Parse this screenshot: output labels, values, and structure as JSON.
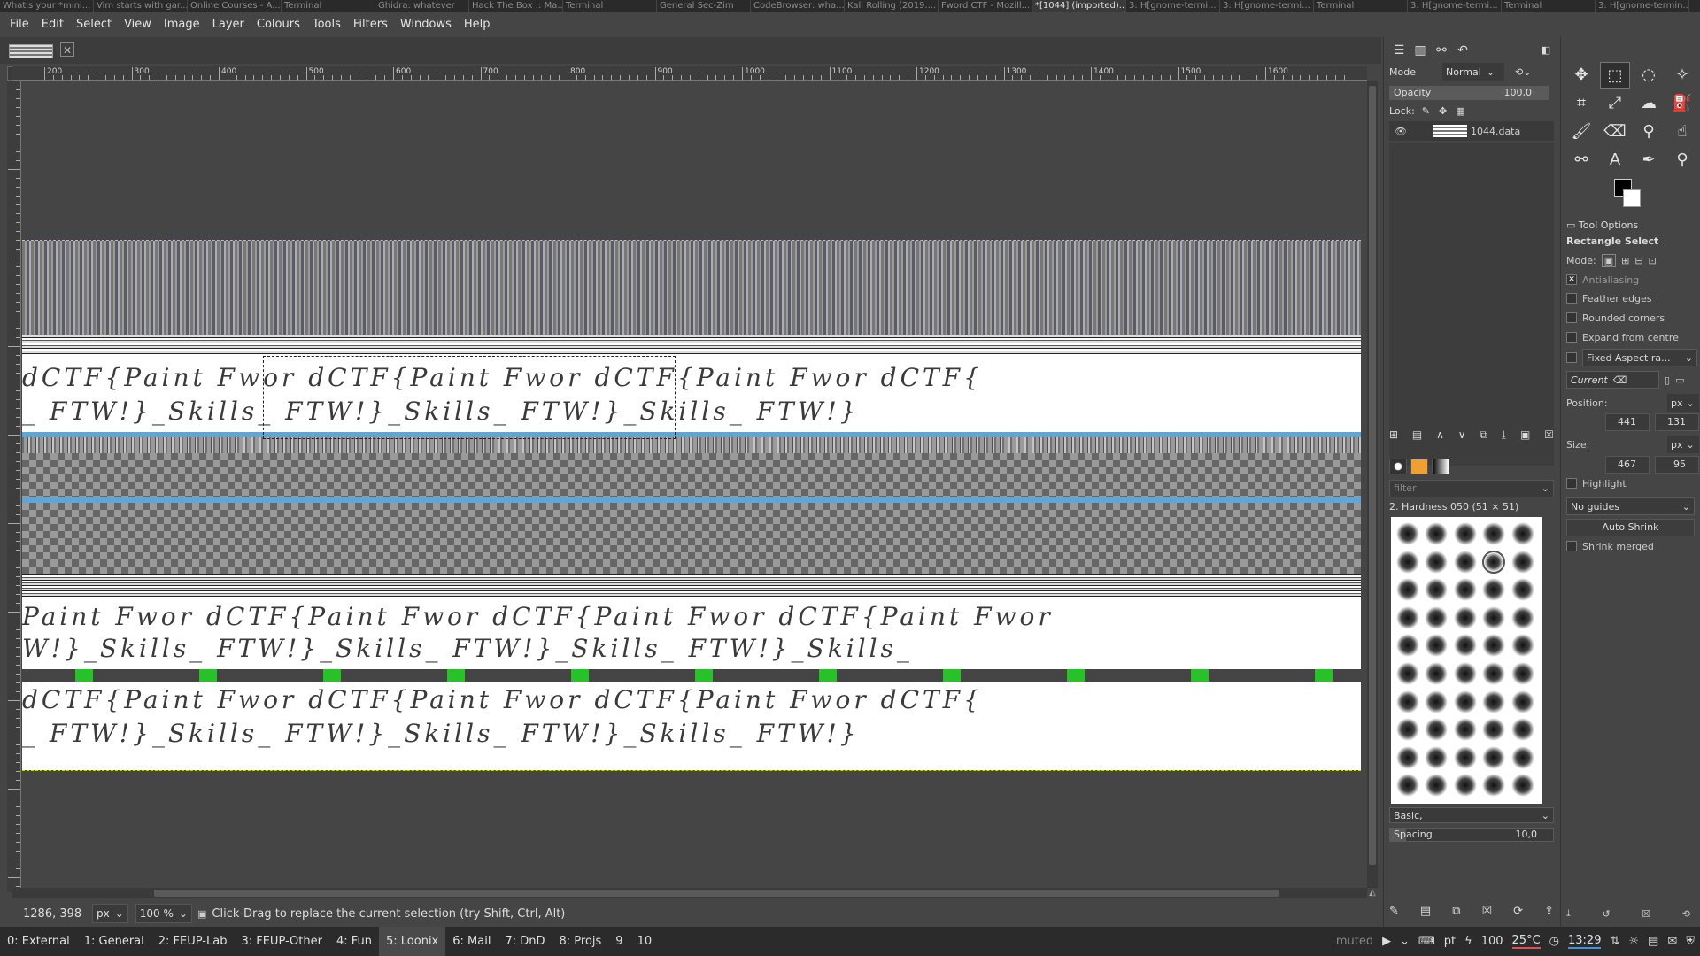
{
  "title_tabs": [
    "What's your *mini...",
    "Vim starts with gar...",
    "Online Courses - A...",
    "Terminal",
    "Ghidra: whatever",
    "Hack The Box :: Ma...",
    "Terminal",
    "General Sec-Zim",
    "CodeBrowser: wha...",
    "Kali Rolling (2019....",
    "Fword CTF - Mozill...",
    "*[1044] (imported)...",
    "3: H[gnome-termi...",
    "3: H[gnome-termi...",
    "Terminal",
    "3: H[gnome-termi...",
    "Terminal",
    "3: H[gnome-termin..."
  ],
  "active_title_tab": 11,
  "menu": [
    "File",
    "Edit",
    "Select",
    "View",
    "Image",
    "Layer",
    "Colours",
    "Tools",
    "Filters",
    "Windows",
    "Help"
  ],
  "ruler_labels": [
    "200",
    "300",
    "400",
    "500",
    "600",
    "700",
    "800",
    "900",
    "1000",
    "1100",
    "1200",
    "1300",
    "1400",
    "1500",
    "1600"
  ],
  "canvas_text": {
    "line1": "dCTF{Paint Fwor dCTF{Paint Fwor dCTF{Paint Fwor dCTF{",
    "line2": "_ FTW!}_Skills_ FTW!}_Skills_ FTW!}_Skills_ FTW!}",
    "line3": "Paint Fwor dCTF{Paint Fwor dCTF{Paint Fwor dCTF{Paint Fwor",
    "line4": "W!}_Skills_ FTW!}_Skills_ FTW!}_Skills_ FTW!}_Skills_",
    "line5": "dCTF{Paint Fwor dCTF{Paint Fwor dCTF{Paint Fwor dCTF{",
    "line6": "_ FTW!}_Skills_ FTW!}_Skills_ FTW!}_Skills_ FTW!}"
  },
  "status": {
    "coords": "1286, 398",
    "unit": "px",
    "zoom": "100 %",
    "message": "Click-Drag to replace the current selection (try Shift, Ctrl, Alt)"
  },
  "layers": {
    "mode_label": "Mode",
    "mode_value": "Normal",
    "opacity_label": "Opacity",
    "opacity_value": "100,0",
    "opacity_fraction": 1.0,
    "lock_label": "Lock:",
    "layer_name": "1044.data"
  },
  "brushes": {
    "filter_placeholder": "filter",
    "current_brush": "2. Hardness 050 (51 × 51)",
    "preset": "Basic,",
    "spacing_label": "Spacing",
    "spacing_value": "10,0"
  },
  "tool_options": {
    "header": "Tool Options",
    "title": "Rectangle Select",
    "mode_label": "Mode:",
    "antialiasing": "Antialiasing",
    "feather": "Feather edges",
    "rounded": "Rounded corners",
    "expand": "Expand from centre",
    "fixed": "Fixed Aspect ra...",
    "current": "Current",
    "position_label": "Position:",
    "pos_unit": "px",
    "pos_x": "441",
    "pos_y": "131",
    "size_label": "Size:",
    "size_unit": "px",
    "size_w": "467",
    "size_h": "95",
    "highlight": "Highlight",
    "guides": "No guides",
    "auto_shrink": "Auto Shrink",
    "shrink_merged": "Shrink merged"
  },
  "taskbar": {
    "workspaces": [
      "0: External",
      "1: General",
      "2: FEUP-Lab",
      "3: FEUP-Other",
      "4: Fun",
      "5: Loonix",
      "6: Mail",
      "7: DnD",
      "8: Projs",
      "9",
      "10"
    ],
    "active_workspace": 5,
    "muted": "muted",
    "layout": "pt",
    "brightness": "100",
    "temp": "25°C",
    "time": "13:29"
  }
}
